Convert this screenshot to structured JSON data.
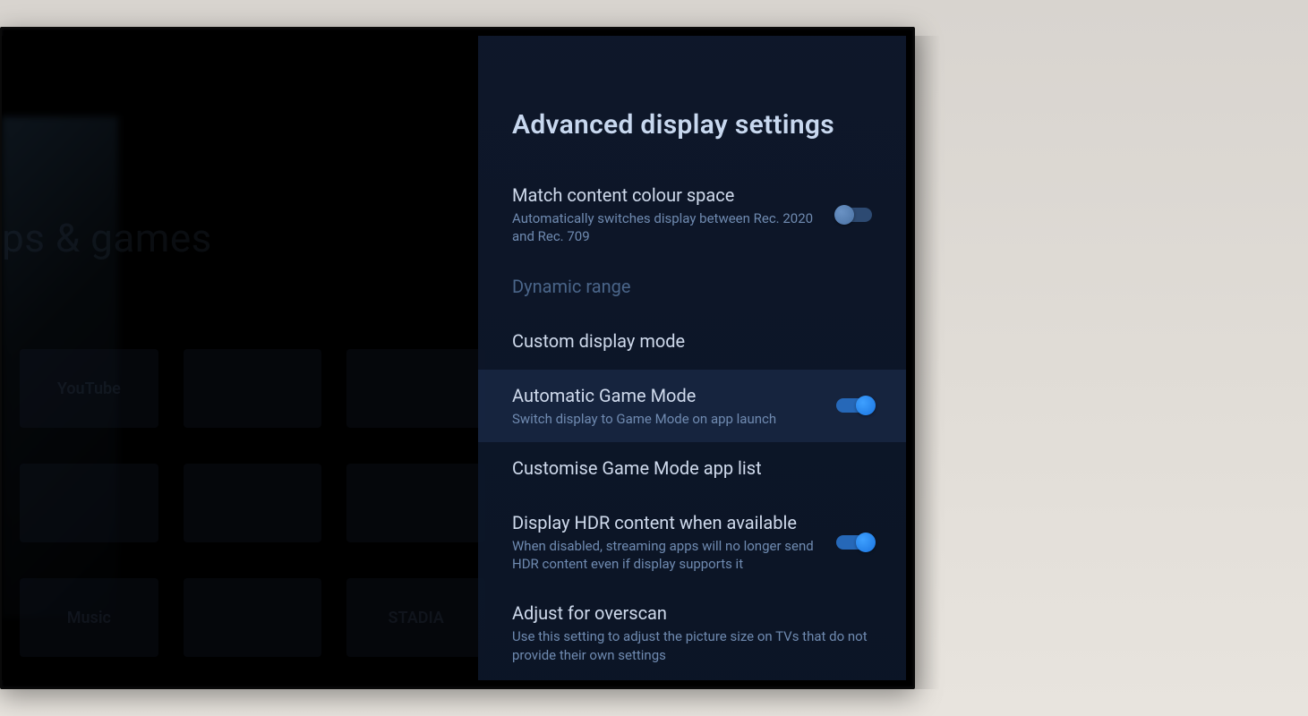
{
  "background": {
    "section_title": "ps & games",
    "tiles": [
      [
        "YouTube",
        "",
        ""
      ],
      [
        "",
        "",
        ""
      ],
      [
        "Music",
        "",
        "STADIA"
      ]
    ]
  },
  "panel": {
    "title": "Advanced display settings",
    "items": [
      {
        "label": "Match content colour space",
        "desc": "Automatically switches display between Rec. 2020 and Rec. 709",
        "toggle": "on-dim"
      },
      {
        "label": "Dynamic range",
        "desc": "",
        "dim": true
      },
      {
        "label": "Custom display mode",
        "desc": ""
      },
      {
        "label": "Automatic Game Mode",
        "desc": "Switch display to Game Mode on app launch",
        "toggle": "on-bright",
        "highlighted": true
      },
      {
        "label": "Customise Game Mode app list",
        "desc": ""
      },
      {
        "label": "Display HDR content when available",
        "desc": "When disabled, streaming apps will no longer send HDR content even if display supports it",
        "toggle": "on-bright"
      },
      {
        "label": "Adjust for overscan",
        "desc": "Use this setting to adjust the picture size on TVs that do not provide their own settings"
      }
    ]
  }
}
